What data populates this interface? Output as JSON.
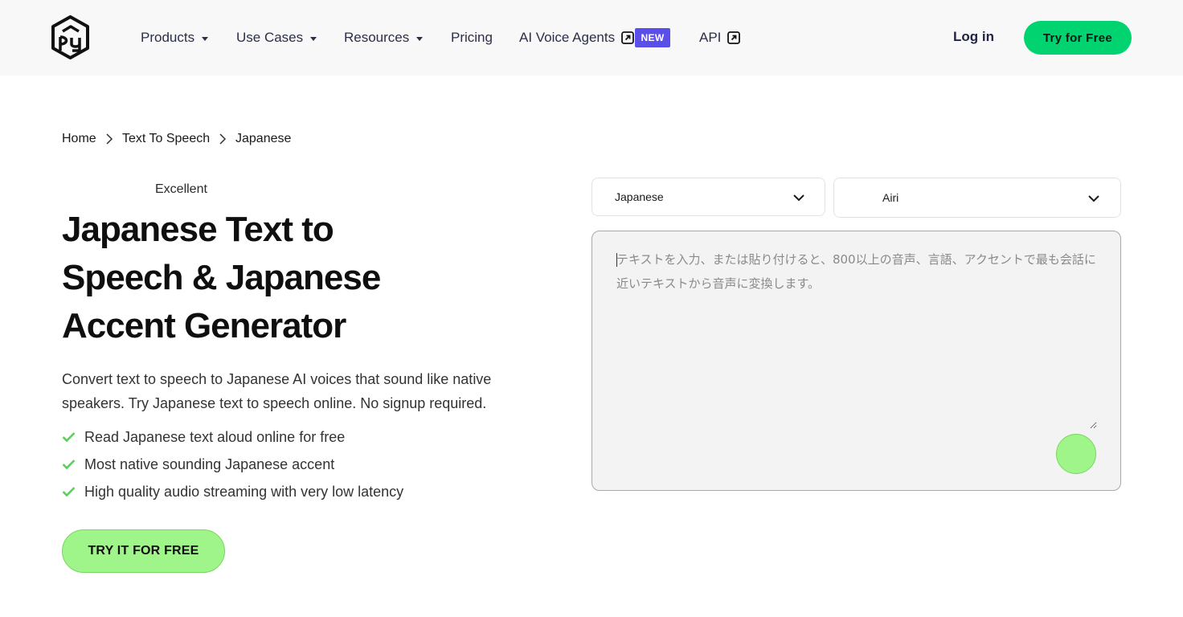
{
  "header": {
    "logo_alt": "PlayHT logo",
    "nav": [
      {
        "label": "Products",
        "dropdown": true
      },
      {
        "label": "Use Cases",
        "dropdown": true
      },
      {
        "label": "Resources",
        "dropdown": true
      },
      {
        "label": "Pricing",
        "dropdown": false
      },
      {
        "label": "AI Voice Agents",
        "external": true
      },
      {
        "label": "API",
        "external": true
      }
    ],
    "new_badge": "NEW",
    "login_label": "Log in",
    "try_label": "Try for Free"
  },
  "breadcrumb": [
    "Home",
    "Text To Speech",
    "Japanese"
  ],
  "hero": {
    "rating": "Excellent",
    "title": "Japanese Text to Speech & Japanese Accent Generator",
    "description": "Convert text to speech to Japanese AI voices that sound like native speakers. Try Japanese text to speech online. No signup required.",
    "features": [
      "Read Japanese text aloud online for free",
      "Most native sounding Japanese accent",
      "High quality audio streaming with very low latency"
    ],
    "cta": "TRY IT FOR FREE"
  },
  "tts": {
    "language": "Japanese",
    "voice": "Airi",
    "placeholder": "テキストを入力、または貼り付けると、800以上の音声、言語、アクセントで最も会話に近いテキストから音声に変換します。"
  },
  "colors": {
    "brand_green": "#00d36f",
    "light_green": "#a0f58a",
    "new_badge": "#5b4fe9",
    "check_green": "#5ad05a"
  },
  "icons": [
    "logo-icon",
    "caret-down-icon",
    "external-link-icon",
    "chevron-right-icon",
    "check-icon",
    "chevron-down-icon"
  ]
}
